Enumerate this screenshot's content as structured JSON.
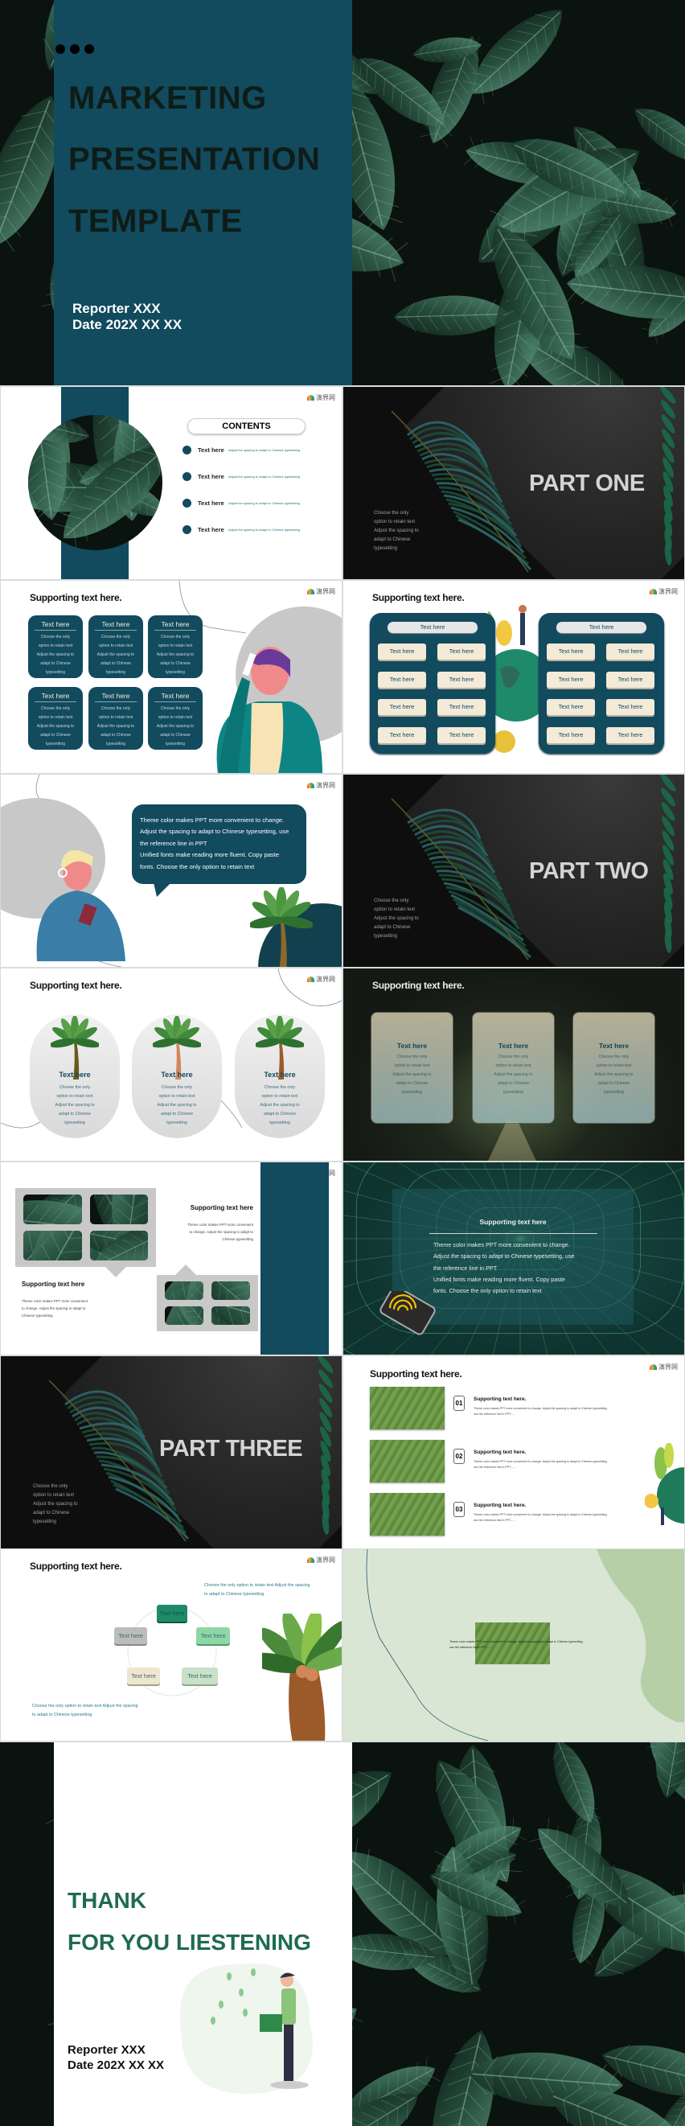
{
  "logo_text": "演界网",
  "colors": {
    "primary_teal": "#124a5e",
    "dark_green_text": "#1e6b50",
    "leaf_dark": "#0a130f",
    "light_green_bg": "#d9e6d4"
  },
  "title_slide": {
    "title_lines": [
      "MARKETING",
      "PRESENTATION",
      "TEMPLATE"
    ],
    "reporter": "Reporter XXX",
    "date": "Date 202X XX XX"
  },
  "contents_slide": {
    "heading": "CONTENTS",
    "items": [
      {
        "label": "Text here",
        "desc": "Adjust the spacing to adapt to Chinese typesetting"
      },
      {
        "label": "Text here",
        "desc": "Adjust the spacing to adapt to Chinese typesetting"
      },
      {
        "label": "Text here",
        "desc": "Adjust the spacing to adapt to Chinese typesetting"
      },
      {
        "label": "Text here",
        "desc": "Adjust the spacing to adapt to Chinese typesetting"
      }
    ]
  },
  "part_one": {
    "title": "PART ONE",
    "lines": [
      "Choose the only",
      "option to retain text",
      "Adjust the spacing to",
      "adapt to Chinese",
      "typesetting"
    ]
  },
  "grid_slide": {
    "heading": "Supporting text here.",
    "cards": [
      {
        "title": "Text here",
        "lines": [
          "Choose the only",
          "option to retain text",
          "Adjust the spacing to",
          "adapt to Chinese",
          "typesetting"
        ]
      },
      {
        "title": "Text here",
        "lines": [
          "Choose the only",
          "option to retain text",
          "Adjust the spacing to",
          "adapt to Chinese",
          "typesetting"
        ]
      },
      {
        "title": "Text here",
        "lines": [
          "Choose the only",
          "option to retain text",
          "Adjust the spacing to",
          "adapt to Chinese",
          "typesetting"
        ]
      },
      {
        "title": "Text here",
        "lines": [
          "Choose the only",
          "option to retain text",
          "Adjust the spacing to",
          "adapt to Chinese",
          "typesetting"
        ]
      },
      {
        "title": "Text here",
        "lines": [
          "Choose the only",
          "option to retain text",
          "Adjust the spacing to",
          "adapt to Chinese",
          "typesetting"
        ]
      },
      {
        "title": "Text here",
        "lines": [
          "Choose the only",
          "option to retain text",
          "Adjust the spacing to",
          "adapt to Chinese",
          "typesetting"
        ]
      }
    ]
  },
  "panels_slide": {
    "heading": "Supporting text here.",
    "panels": [
      {
        "header": "Text here",
        "buttons": [
          "Text here",
          "Text here",
          "Text here",
          "Text here",
          "Text here",
          "Text here",
          "Text here",
          "Text here"
        ]
      },
      {
        "header": "Text here",
        "buttons": [
          "Text here",
          "Text here",
          "Text here",
          "Text here",
          "Text here",
          "Text here",
          "Text here",
          "Text here"
        ]
      }
    ]
  },
  "bubble_slide": {
    "lines": [
      "Theme color makes PPT more convenient to change.",
      "Adjust the spacing to adapt to Chinese typesetting, use",
      "the reference line in PPT",
      "Unified fonts make reading more fluent. Copy paste",
      "fonts. Choose the only option to retain text"
    ]
  },
  "part_two": {
    "title": "PART TWO",
    "lines": [
      "Choose the only",
      "option to retain text",
      "Adjust the spacing to",
      "adapt to Chinese",
      "typesetting"
    ]
  },
  "palms_slide": {
    "heading": "Supporting text here.",
    "cards": [
      {
        "title": "Text here",
        "lines": [
          "Choose the only",
          "option to retain text",
          "Adjust the spacing to",
          "adapt to Chinese",
          "typesetting"
        ]
      },
      {
        "title": "Text here",
        "lines": [
          "Choose the only",
          "option to retain text",
          "Adjust the spacing to",
          "adapt to Chinese",
          "typesetting"
        ]
      },
      {
        "title": "Text here",
        "lines": [
          "Choose the only",
          "option to retain text",
          "Adjust the spacing to",
          "adapt to Chinese",
          "typesetting"
        ]
      }
    ]
  },
  "forest_slide": {
    "heading": "Supporting text here.",
    "cards": [
      {
        "title": "Text here",
        "lines": [
          "Choose the only",
          "option to retain text",
          "Adjust the spacing to",
          "adapt to Chinese",
          "typesetting"
        ]
      },
      {
        "title": "Text here",
        "lines": [
          "Choose the only",
          "option to retain text",
          "Adjust the spacing to",
          "adapt to Chinese",
          "typesetting"
        ]
      },
      {
        "title": "Text here",
        "lines": [
          "Choose the only",
          "option to retain text",
          "Adjust the spacing to",
          "adapt to Chinese",
          "typesetting"
        ]
      }
    ]
  },
  "gallery_slide": {
    "blocks": [
      {
        "heading": "Supporting text here",
        "lines": [
          "Theme color makes PPT more convenient",
          "to change. Adjust the spacing to adapt to",
          "Chinese typesetting"
        ]
      },
      {
        "heading": "Supporting text here",
        "lines": [
          "Theme color makes PPT more convenient",
          "to change. Adjust the spacing to adapt to",
          "Chinese typesetting"
        ]
      }
    ]
  },
  "tunnel_slide": {
    "heading": "Supporting text here",
    "lines": [
      "Theme color makes PPT more convenient to change.",
      "Adjust the spacing to adapt to Chinese typesetting, use",
      "the reference line in PPT",
      "Unified fonts make reading more fluent. Copy paste",
      "fonts. Choose the only option to retain text"
    ]
  },
  "part_three": {
    "title": "PART THREE",
    "lines": [
      "Choose the only",
      "option to retain text",
      "Adjust the spacing to",
      "adapt to Chinese",
      "typesetting"
    ]
  },
  "numbered_slide": {
    "heading": "Supporting text here.",
    "items": [
      {
        "num": "01",
        "title": "Supporting text here.",
        "desc": "Theme color makes PPT more convenient to change. Adjust the spacing to adapt to Chinese typesetting, use the reference line in PPT......"
      },
      {
        "num": "02",
        "title": "Supporting text here.",
        "desc": "Theme color makes PPT more convenient to change. Adjust the spacing to adapt to Chinese typesetting, use the reference line in PPT......"
      },
      {
        "num": "03",
        "title": "Supporting text here.",
        "desc": "Theme color makes PPT more convenient to change. Adjust the spacing to adapt to Chinese typesetting, use the reference line in PPT......"
      }
    ]
  },
  "cycle_slide": {
    "heading": "Supporting text here.",
    "top_text": "Choose the only option to retain text Adjust the spacing to adapt to Chinese typesetting",
    "bottom_text": "Choose the only option to retain text Adjust the spacing to adapt to Chinese typesetting",
    "nodes": [
      "Text here",
      "Text here",
      "Text here",
      "Text here",
      "Text here"
    ]
  },
  "image_text_slide": {
    "text": "Theme color makes PPT more convenient to change. Adjust the spacing to adapt to Chinese typesetting, use the reference line in PPT......"
  },
  "thanks_slide": {
    "lines": [
      "THANK",
      "FOR YOU LIESTENING"
    ],
    "reporter": "Reporter XXX",
    "date": "Date 202X XX XX"
  }
}
